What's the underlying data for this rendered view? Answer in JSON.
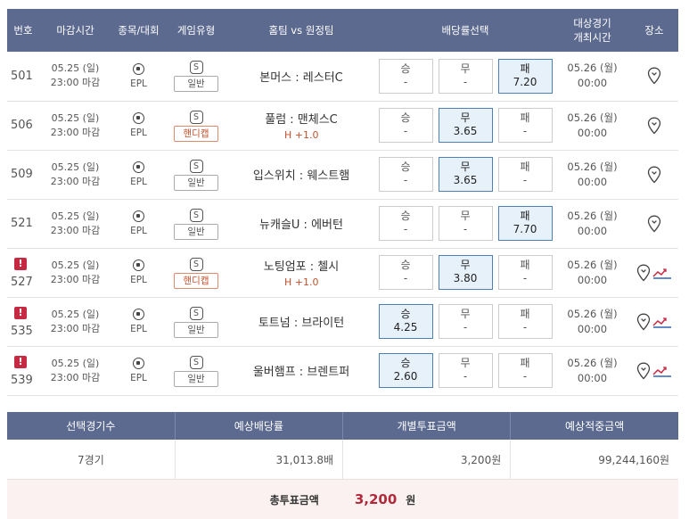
{
  "header": {
    "topcut": "",
    "columns": {
      "no": "번호",
      "deadline": "마감시간",
      "league": "종목/대회",
      "type": "게임유형",
      "match": "홈팀 vs 원정팀",
      "odds": "배당률선택",
      "event_line1": "대상경기",
      "event_line2": "개최시간",
      "venue": "장소"
    }
  },
  "games": [
    {
      "no": "501",
      "alert": false,
      "deadline_date": "05.25 (일)",
      "deadline_time": "23:00 마감",
      "league": "EPL",
      "type_icon": "S",
      "type": "일반",
      "handicap_type": false,
      "match": "본머스 : 레스터C",
      "handicap": "",
      "odds": [
        {
          "label": "승",
          "value": "-",
          "selected": false
        },
        {
          "label": "무",
          "value": "-",
          "selected": false
        },
        {
          "label": "패",
          "value": "7.20",
          "selected": true
        }
      ],
      "event_date": "05.26 (월)",
      "event_time": "00:00",
      "trend": false
    },
    {
      "no": "506",
      "alert": false,
      "deadline_date": "05.25 (일)",
      "deadline_time": "23:00 마감",
      "league": "EPL",
      "type_icon": "S",
      "type": "핸디캡",
      "handicap_type": true,
      "match": "풀럼 : 맨체스C",
      "handicap": "H +1.0",
      "odds": [
        {
          "label": "승",
          "value": "-",
          "selected": false
        },
        {
          "label": "무",
          "value": "3.65",
          "selected": true
        },
        {
          "label": "패",
          "value": "-",
          "selected": false
        }
      ],
      "event_date": "05.26 (월)",
      "event_time": "00:00",
      "trend": false
    },
    {
      "no": "509",
      "alert": false,
      "deadline_date": "05.25 (일)",
      "deadline_time": "23:00 마감",
      "league": "EPL",
      "type_icon": "S",
      "type": "일반",
      "handicap_type": false,
      "match": "입스위치 : 웨스트햄",
      "handicap": "",
      "odds": [
        {
          "label": "승",
          "value": "-",
          "selected": false
        },
        {
          "label": "무",
          "value": "3.65",
          "selected": true
        },
        {
          "label": "패",
          "value": "-",
          "selected": false
        }
      ],
      "event_date": "05.26 (월)",
      "event_time": "00:00",
      "trend": false
    },
    {
      "no": "521",
      "alert": false,
      "deadline_date": "05.25 (일)",
      "deadline_time": "23:00 마감",
      "league": "EPL",
      "type_icon": "S",
      "type": "일반",
      "handicap_type": false,
      "match": "뉴캐슬U : 에버턴",
      "handicap": "",
      "odds": [
        {
          "label": "승",
          "value": "-",
          "selected": false
        },
        {
          "label": "무",
          "value": "-",
          "selected": false
        },
        {
          "label": "패",
          "value": "7.70",
          "selected": true
        }
      ],
      "event_date": "05.26 (월)",
      "event_time": "00:00",
      "trend": false
    },
    {
      "no": "527",
      "alert": true,
      "deadline_date": "05.25 (일)",
      "deadline_time": "23:00 마감",
      "league": "EPL",
      "type_icon": "S",
      "type": "핸디캡",
      "handicap_type": true,
      "match": "노팅엄포 : 첼시",
      "handicap": "H +1.0",
      "odds": [
        {
          "label": "승",
          "value": "-",
          "selected": false
        },
        {
          "label": "무",
          "value": "3.80",
          "selected": true
        },
        {
          "label": "패",
          "value": "-",
          "selected": false
        }
      ],
      "event_date": "05.26 (월)",
      "event_time": "00:00",
      "trend": true
    },
    {
      "no": "535",
      "alert": true,
      "deadline_date": "05.25 (일)",
      "deadline_time": "23:00 마감",
      "league": "EPL",
      "type_icon": "S",
      "type": "일반",
      "handicap_type": false,
      "match": "토트넘 : 브라이턴",
      "handicap": "",
      "odds": [
        {
          "label": "승",
          "value": "4.25",
          "selected": true
        },
        {
          "label": "무",
          "value": "-",
          "selected": false
        },
        {
          "label": "패",
          "value": "-",
          "selected": false
        }
      ],
      "event_date": "05.26 (월)",
      "event_time": "00:00",
      "trend": true
    },
    {
      "no": "539",
      "alert": true,
      "deadline_date": "05.25 (일)",
      "deadline_time": "23:00 마감",
      "league": "EPL",
      "type_icon": "S",
      "type": "일반",
      "handicap_type": false,
      "match": "울버햄프 : 브렌트퍼",
      "handicap": "",
      "odds": [
        {
          "label": "승",
          "value": "2.60",
          "selected": true
        },
        {
          "label": "무",
          "value": "-",
          "selected": false
        },
        {
          "label": "패",
          "value": "-",
          "selected": false
        }
      ],
      "event_date": "05.26 (월)",
      "event_time": "00:00",
      "trend": true
    }
  ],
  "summary": {
    "headers": [
      "선택경기수",
      "예상배당률",
      "개별투표금액",
      "예상적중금액"
    ],
    "values": [
      "7경기",
      "31,013.8배",
      "3,200원",
      "99,244,160원"
    ],
    "total_label": "총투표금액",
    "total_value": "3,200",
    "total_unit": "원"
  },
  "colors": {
    "header_bg": "#5c6a8f",
    "selected_bg": "#e7f1fa",
    "selected_border": "#4f7fb4",
    "alert": "#c62a43",
    "handicap": "#c2502d",
    "total_bg": "#fbf1f1",
    "total_value": "#b12a3c"
  }
}
